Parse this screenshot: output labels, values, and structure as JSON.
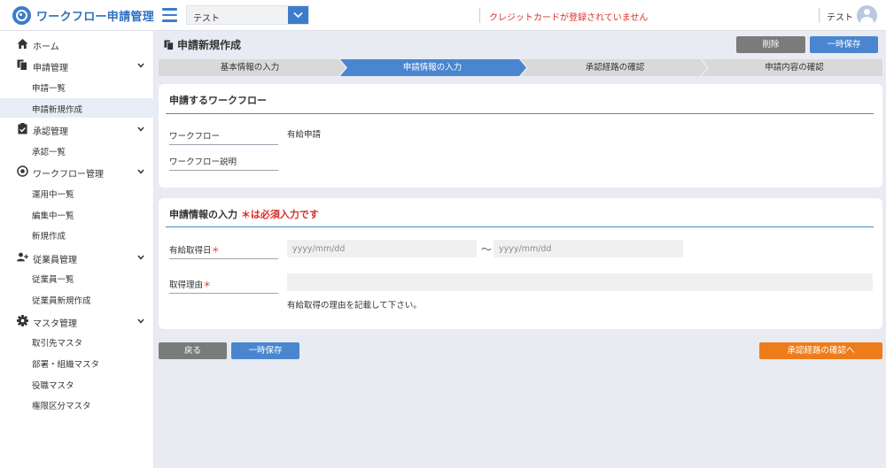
{
  "header": {
    "app_title": "ワークフロー申請管理",
    "select_value": "テスト",
    "alert": "クレジットカードが登録されていません",
    "user_name": "テスト"
  },
  "sidebar": {
    "home": "ホーム",
    "groups": [
      {
        "label": "申請管理",
        "icon": "document-icon",
        "items": [
          "申請一覧",
          "申請新規作成"
        ]
      },
      {
        "label": "承認管理",
        "icon": "clipboard-check-icon",
        "items": [
          "承認一覧"
        ]
      },
      {
        "label": "ワークフロー管理",
        "icon": "target-icon",
        "items": [
          "運用中一覧",
          "編集中一覧",
          "新規作成"
        ]
      },
      {
        "label": "従業員管理",
        "icon": "user-plus-icon",
        "items": [
          "従業員一覧",
          "従業員新規作成"
        ]
      },
      {
        "label": "マスタ管理",
        "icon": "gear-icon",
        "items": [
          "取引先マスタ",
          "部署・組織マスタ",
          "役職マスタ",
          "権限区分マスタ"
        ]
      }
    ],
    "active_item": "申請新規作成"
  },
  "page": {
    "title": "申請新規作成",
    "delete_label": "削除",
    "temp_save_label": "一時保存"
  },
  "steps": [
    {
      "label": "基本情報の入力",
      "state": "done"
    },
    {
      "label": "申請情報の入力",
      "state": "active"
    },
    {
      "label": "承認経路の確認",
      "state": "todo"
    },
    {
      "label": "申請内容の確認",
      "state": "todo"
    }
  ],
  "workflow_card": {
    "title": "申請するワークフロー",
    "workflow_label": "ワークフロー",
    "workflow_value": "有給申請",
    "description_label": "ワークフロー説明",
    "description_value": ""
  },
  "input_card": {
    "title": "申請情報の入力",
    "required_note": "＊は必須入力です",
    "date_label": "有給取得日",
    "date_required": "＊",
    "date_from_placeholder": "yyyy/mm/dd",
    "date_separator": "〜",
    "date_to_placeholder": "yyyy/mm/dd",
    "reason_label": "取得理由",
    "reason_required": "＊",
    "reason_value": "",
    "reason_hint": "有給取得の理由を記載して下さい。"
  },
  "footer": {
    "back_label": "戻る",
    "temp_save_label": "一時保存",
    "next_label": "承認経路の確認へ"
  },
  "colors": {
    "accent": "#4a86d0",
    "brand": "#2f6fc0",
    "alert": "#d9302a",
    "orange": "#ef7c1a",
    "step_inactive": "#d9d9d9"
  }
}
